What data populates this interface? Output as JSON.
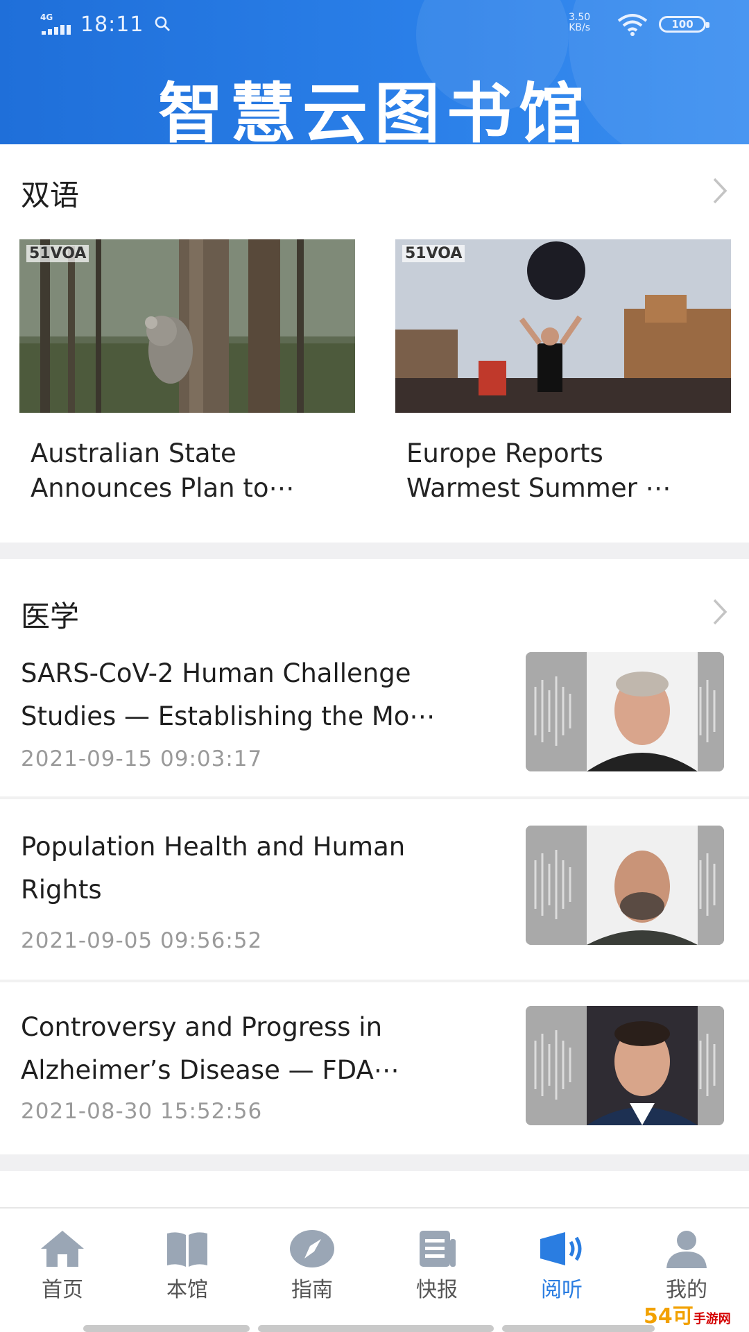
{
  "status_bar": {
    "network": "4G",
    "time": "18:11",
    "speed_value": "3.50",
    "speed_unit": "KB/s",
    "battery": "100"
  },
  "app": {
    "title": "智慧云图书馆"
  },
  "bilingual": {
    "title": "双语",
    "items": [
      {
        "logo": "51VOA",
        "title_line1": "Australian State",
        "title_line2": "Announces Plan to⋯"
      },
      {
        "logo": "51VOA",
        "title_line1": "Europe Reports",
        "title_line2": "Warmest Summer ⋯"
      }
    ]
  },
  "medicine": {
    "title": "医学",
    "items": [
      {
        "title_line1": "SARS-CoV-2 Human Challenge",
        "title_line2": "Studies — Establishing the Mo⋯",
        "date": "2021-09-15 09:03:17"
      },
      {
        "title_line1": "Population Health and Human",
        "title_line2": "Rights",
        "date": "2021-09-05 09:56:52"
      },
      {
        "title_line1": "Controversy and Progress in",
        "title_line2": "Alzheimer’s Disease — FDA⋯",
        "date": "2021-08-30 15:52:56"
      }
    ]
  },
  "tabbar": {
    "active_color": "#2a7de1",
    "inactive_color": "#9aa6b5",
    "items": [
      {
        "label": "首页",
        "icon": "home-icon"
      },
      {
        "label": "本馆",
        "icon": "book-icon"
      },
      {
        "label": "指南",
        "icon": "compass-icon"
      },
      {
        "label": "快报",
        "icon": "news-icon"
      },
      {
        "label": "阅听",
        "icon": "speaker-icon"
      },
      {
        "label": "我的",
        "icon": "user-icon"
      }
    ]
  },
  "watermark": {
    "main": "54可",
    "sub": "手游网"
  }
}
